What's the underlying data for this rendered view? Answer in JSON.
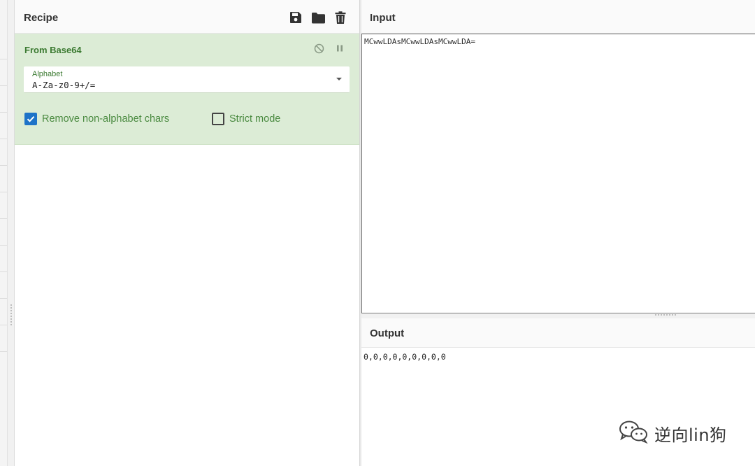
{
  "recipe": {
    "title": "Recipe",
    "icons": [
      "save-icon",
      "folder-icon",
      "trash-icon"
    ],
    "operation": {
      "name": "From Base64",
      "alphabet_label": "Alphabet",
      "alphabet_value": "A-Za-z0-9+/=",
      "options": [
        {
          "label": "Remove non-alphabet chars",
          "checked": true
        },
        {
          "label": "Strict mode",
          "checked": false
        }
      ]
    }
  },
  "input": {
    "title": "Input",
    "text": "MCwwLDAsMCwwLDAsMCwwLDA="
  },
  "output": {
    "title": "Output",
    "text": "0,0,0,0,0,0,0,0,0"
  },
  "watermark": {
    "text": "逆向lin狗"
  },
  "colors": {
    "operation_bg": "#dcecd6",
    "operation_text": "#3b7a31",
    "checkbox_checked": "#1e73c8"
  }
}
